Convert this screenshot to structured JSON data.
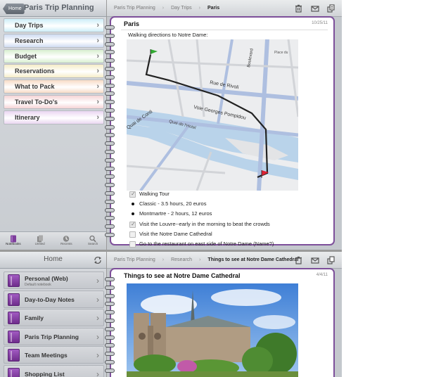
{
  "top": {
    "left": {
      "home_button": "Home",
      "notebook_title": "Paris Trip Planning",
      "sections": [
        {
          "label": "Day Trips",
          "color": "#cdeef8"
        },
        {
          "label": "Research",
          "color": "#cfdcf2"
        },
        {
          "label": "Budget",
          "color": "#d8efd0"
        },
        {
          "label": "Reservations",
          "color": "#f6edc8"
        },
        {
          "label": "What to Pack",
          "color": "#f8dcc6"
        },
        {
          "label": "Travel To-Do's",
          "color": "#f6d4d6"
        },
        {
          "label": "Itinerary",
          "color": "#ead6f1"
        }
      ],
      "tabs": [
        {
          "label": "Notebooks",
          "icon": "notebooks-icon"
        },
        {
          "label": "Unfiled",
          "icon": "unfiled-icon"
        },
        {
          "label": "Recents",
          "icon": "recents-icon"
        },
        {
          "label": "Search",
          "icon": "search-icon"
        }
      ]
    },
    "right": {
      "breadcrumb": [
        "Paris Trip Planning",
        "Day Trips",
        "Paris"
      ],
      "icons": [
        "trash-icon",
        "email-icon",
        "share-icon"
      ],
      "page": {
        "title": "Paris",
        "date": "10/25/11",
        "intro": "Walking directions to Notre Dame:",
        "map_labels": [
          "Rue de Rivoli",
          "Voie Georges Pompidou",
          "Quai de Conti",
          "Boulevard",
          "Quai de l'Hotel",
          "Place du"
        ],
        "items": [
          {
            "type": "check",
            "checked": true,
            "text": "Walking Tour"
          },
          {
            "type": "bullet",
            "text": "Classic - 3.5 hours, 20 euros"
          },
          {
            "type": "bullet",
            "text": "Montmartre - 2 hours, 12 euros"
          },
          {
            "type": "check",
            "checked": true,
            "text": "Visit the Louvre--early in the morning to beat the crowds"
          },
          {
            "type": "check",
            "checked": false,
            "text": "Visit the Notre Dame Cathedral"
          },
          {
            "type": "check",
            "checked": false,
            "text": "Go to the restaurant on east side of Notre Dame (Name?)"
          }
        ]
      }
    }
  },
  "bottom": {
    "left": {
      "title": "Home",
      "notebooks": [
        {
          "name": "Personal (Web)",
          "sub": "Default notebook"
        },
        {
          "name": "Day-to-Day Notes",
          "sub": ""
        },
        {
          "name": "Family",
          "sub": ""
        },
        {
          "name": "Paris Trip Planning",
          "sub": ""
        },
        {
          "name": "Team Meetings",
          "sub": ""
        },
        {
          "name": "Shopping List",
          "sub": ""
        }
      ]
    },
    "right": {
      "breadcrumb": [
        "Paris Trip Planning",
        "Research",
        "Things to see at Notre Dame Cathedral"
      ],
      "page": {
        "title": "Things to see at Notre Dame Cathedral",
        "date": "4/4/11"
      }
    }
  }
}
